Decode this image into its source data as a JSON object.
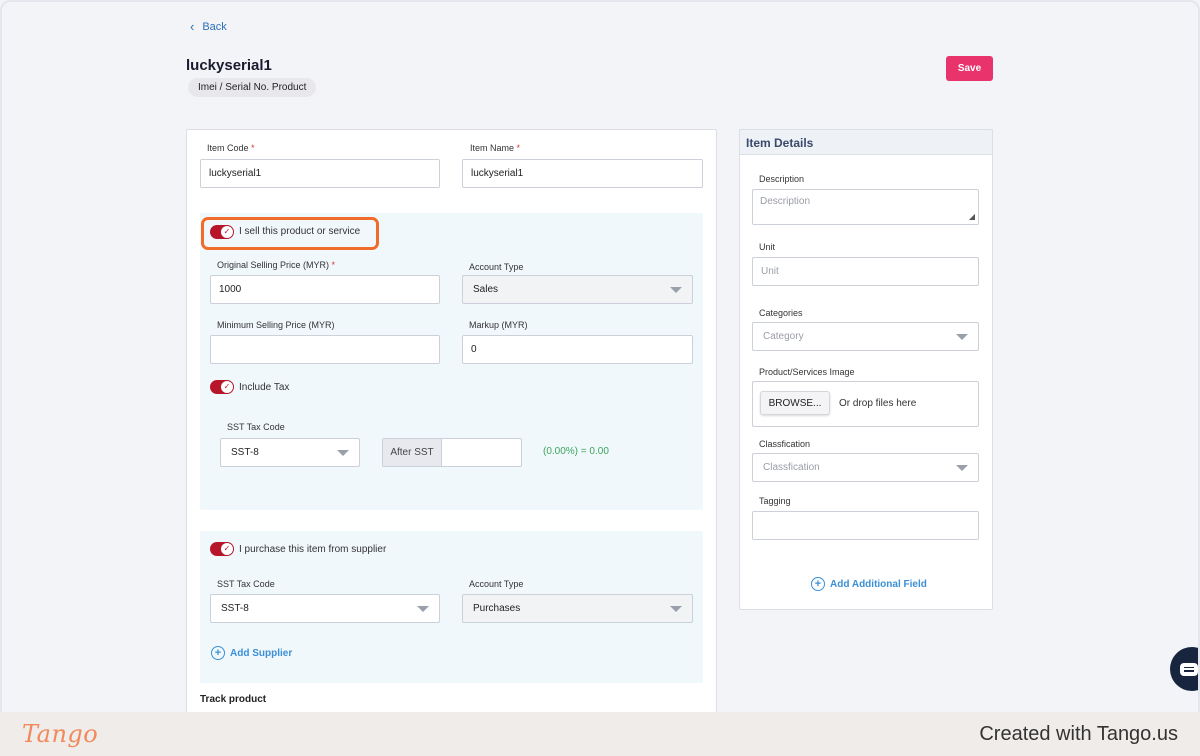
{
  "nav": {
    "back_label": "Back"
  },
  "header": {
    "title": "luckyserial1",
    "type_badge": "Imei / Serial No. Product",
    "save_label": "Save"
  },
  "main": {
    "item_code": {
      "label": "Item Code",
      "value": "luckyserial1"
    },
    "item_name": {
      "label": "Item Name",
      "value": "luckyserial1"
    },
    "sell": {
      "toggle_label": "I sell this product or service",
      "original_price": {
        "label": "Original Selling Price (MYR)",
        "value": "1000"
      },
      "account_type": {
        "label": "Account Type",
        "value": "Sales"
      },
      "min_price": {
        "label": "Minimum Selling Price (MYR)",
        "value": ""
      },
      "markup": {
        "label": "Markup (MYR)",
        "value": "0"
      },
      "include_tax_label": "Include Tax",
      "sst_tax_code": {
        "label": "SST Tax Code",
        "value": "SST-8"
      },
      "after_sst_label": "After SST",
      "after_sst_value": "",
      "tax_result": "(0.00%) = 0.00"
    },
    "purchase": {
      "toggle_label": "I purchase this item from supplier",
      "sst_tax_code": {
        "label": "SST Tax Code",
        "value": "SST-8"
      },
      "account_type": {
        "label": "Account Type",
        "value": "Purchases"
      },
      "add_supplier_label": "Add Supplier"
    },
    "track_product_label": "Track product"
  },
  "side": {
    "title": "Item Details",
    "description": {
      "label": "Description",
      "placeholder": "Description"
    },
    "unit": {
      "label": "Unit",
      "placeholder": "Unit"
    },
    "categories": {
      "label": "Categories",
      "placeholder": "Category"
    },
    "image": {
      "label": "Product/Services Image",
      "browse_label": "BROWSE...",
      "drop_text": "Or drop files here"
    },
    "classification": {
      "label": "Classfication",
      "placeholder": "Classfication"
    },
    "tagging": {
      "label": "Tagging",
      "value": ""
    },
    "add_field_label": "Add Additional Field"
  },
  "footer": {
    "logo_text": "Tango",
    "created_with": "Created with Tango.us"
  },
  "colors": {
    "save": "#e8336d",
    "toggle_on": "#b7152a",
    "highlight": "#f16b2b",
    "link": "#3a8fd6",
    "tax_result": "#3aa55a"
  }
}
